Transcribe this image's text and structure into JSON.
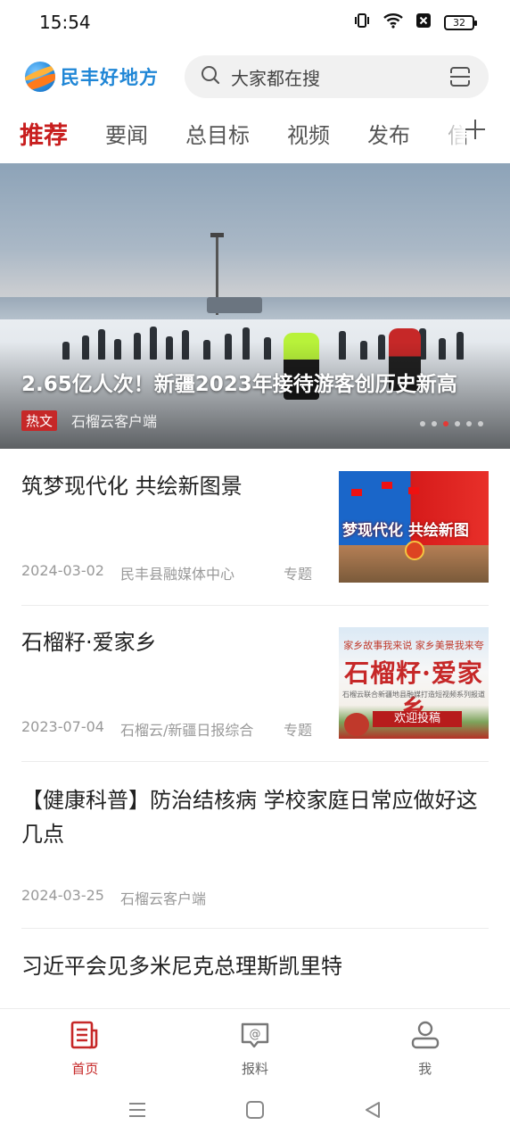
{
  "status_bar": {
    "time": "15:54",
    "battery": "32"
  },
  "header": {
    "app_name": "民丰好地方",
    "search_placeholder": "大家都在搜"
  },
  "tabs": [
    {
      "label": "推荐",
      "active": true
    },
    {
      "label": "要闻",
      "active": false
    },
    {
      "label": "总目标",
      "active": false
    },
    {
      "label": "视频",
      "active": false
    },
    {
      "label": "发布",
      "active": false
    },
    {
      "label": "信",
      "active": false
    }
  ],
  "banner": {
    "title": "2.65亿人次！新疆2023年接待游客创历史新高",
    "tag": "热文",
    "source": "石榴云客户端",
    "page_count": 6,
    "active_page": 3
  },
  "news": [
    {
      "title": "筑梦现代化  共绘新图景",
      "date": "2024-03-02",
      "source": "民丰县融媒体中心",
      "tag": "专题",
      "thumb_text": "梦现代化 共绘新图"
    },
    {
      "title": "石榴籽·爱家乡",
      "date": "2023-07-04",
      "source": "石榴云/新疆日报综合",
      "tag": "专题",
      "thumb_top": "家乡故事我来说 家乡美景我来夸",
      "thumb_main": "石榴籽·爱家乡",
      "thumb_sub": "石榴云联合新疆地县融媒打造短视频系列报道",
      "thumb_btn": "欢迎投稿"
    },
    {
      "title": "【健康科普】防治结核病 学校家庭日常应做好这几点",
      "date": "2024-03-25",
      "source": "石榴云客户端"
    },
    {
      "title": "习近平会见多米尼克总理斯凯里特"
    }
  ],
  "bottom_nav": [
    {
      "label": "首页",
      "icon": "news-icon",
      "active": true
    },
    {
      "label": "报料",
      "icon": "chat-icon",
      "active": false
    },
    {
      "label": "我",
      "icon": "user-icon",
      "active": false
    }
  ],
  "colors": {
    "accent": "#c62828",
    "brand_blue": "#1f86d6"
  }
}
